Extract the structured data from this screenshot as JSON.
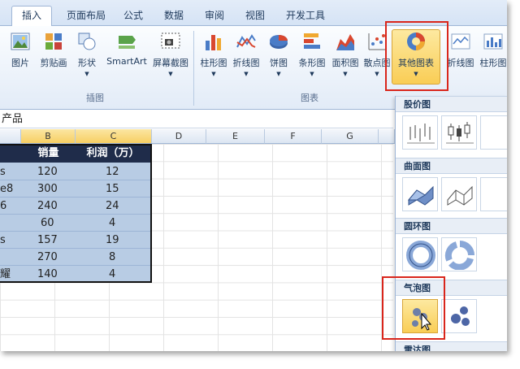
{
  "tabs": [
    "插入",
    "页面布局",
    "公式",
    "数据",
    "审阅",
    "视图",
    "开发工具"
  ],
  "ribbon": {
    "insert_buttons": [
      "图片",
      "剪贴画",
      "形状",
      "SmartArt",
      "屏幕截图"
    ],
    "insert_group": "插图",
    "chart_buttons": [
      "柱形图",
      "折线图",
      "饼图",
      "条形图",
      "面积图",
      "散点图",
      "其他图表",
      "折线图",
      "柱形图"
    ],
    "chart_group": "图表"
  },
  "formula_bar": {
    "value": "产品"
  },
  "columns": [
    "B",
    "C",
    "D",
    "E",
    "F",
    "G"
  ],
  "table": {
    "headers": [
      "销量",
      "利润（万）"
    ],
    "rows": [
      {
        "a": "s",
        "b": "120",
        "c": "12"
      },
      {
        "a": "e8",
        "b": "300",
        "c": "15"
      },
      {
        "a": "6",
        "b": "240",
        "c": "24"
      },
      {
        "a": "",
        "b": "60",
        "c": "4"
      },
      {
        "a": "s",
        "b": "157",
        "c": "19"
      },
      {
        "a": "",
        "b": "270",
        "c": "8"
      },
      {
        "a": "耀",
        "b": "140",
        "c": "4"
      }
    ]
  },
  "gallery": {
    "sections": [
      "股价图",
      "曲面图",
      "圆环图",
      "气泡图",
      "雷达图"
    ]
  },
  "colors": {
    "accent": "#f9cd55",
    "highlight_border": "#d9261c",
    "header_fill": "#1f2c4a",
    "cell_fill": "#b8cce4"
  }
}
